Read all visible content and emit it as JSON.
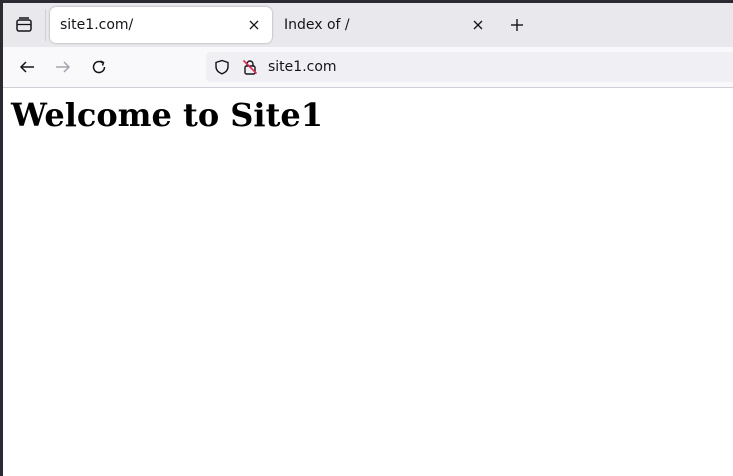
{
  "tabs": [
    {
      "label": "site1.com/",
      "active": true
    },
    {
      "label": "Index of /",
      "active": false
    }
  ],
  "icons": {
    "tab_list": "tab-list-icon",
    "close": "close-icon",
    "new_tab": "plus-icon",
    "back": "back-arrow-icon",
    "forward": "forward-arrow-icon",
    "reload": "reload-icon",
    "shield": "shield-icon",
    "insecure_lock": "insecure-lock-icon"
  },
  "urlbar": {
    "url": "site1.com"
  },
  "page": {
    "heading": "Welcome to Site1"
  },
  "colors": {
    "tabstrip_bg": "#e9e9ed",
    "insecure_red": "#e22850"
  }
}
